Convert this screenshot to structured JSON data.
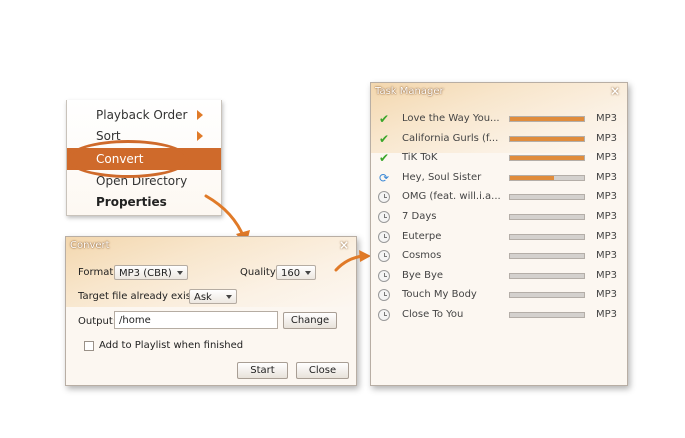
{
  "menu": {
    "items": [
      {
        "label": "Playback Order",
        "submenu": true
      },
      {
        "label": "Sort",
        "submenu": true
      },
      {
        "label": "Convert",
        "selected": true
      },
      {
        "label": "Open Directory",
        "submenu": false
      },
      {
        "label": "Properties",
        "bold": true
      }
    ]
  },
  "convert_dialog": {
    "title": "Convert",
    "close": "×",
    "format_label": "Format:",
    "format_value": "MP3 (CBR)",
    "quality_label": "Quality:",
    "quality_value": "160",
    "target_label": "Target file already exists:",
    "target_value": "Ask",
    "output_label": "Output:",
    "output_value": "/home",
    "change_label": "Change",
    "playlist_label": "Add to Playlist when finished",
    "start_label": "Start",
    "close_label": "Close"
  },
  "task_manager": {
    "title": "Task Manager",
    "close": "×",
    "tasks": [
      {
        "name": "Love the Way You...",
        "status": "done",
        "progress": 1.0,
        "format": "MP3"
      },
      {
        "name": "California Gurls (f...",
        "status": "done",
        "progress": 1.0,
        "format": "MP3"
      },
      {
        "name": "TiK ToK",
        "status": "done",
        "progress": 1.0,
        "format": "MP3"
      },
      {
        "name": "Hey, Soul Sister",
        "status": "converting",
        "progress": 0.6,
        "format": "MP3"
      },
      {
        "name": "OMG (feat. will.i.a...",
        "status": "waiting",
        "progress": 0,
        "format": "MP3"
      },
      {
        "name": "7 Days",
        "status": "waiting",
        "progress": 0,
        "format": "MP3"
      },
      {
        "name": "Euterpe",
        "status": "waiting",
        "progress": 0,
        "format": "MP3"
      },
      {
        "name": "Cosmos",
        "status": "waiting",
        "progress": 0,
        "format": "MP3"
      },
      {
        "name": "Bye Bye",
        "status": "waiting",
        "progress": 0,
        "format": "MP3"
      },
      {
        "name": "Touch My Body",
        "status": "waiting",
        "progress": 0,
        "format": "MP3"
      },
      {
        "name": "Close To You",
        "status": "waiting",
        "progress": 0,
        "format": "MP3"
      }
    ]
  },
  "colors": {
    "accent": "#cf6a2b",
    "progress_fill": "#e08c3c",
    "done": "#3aa62a",
    "converting": "#3a88d6"
  }
}
